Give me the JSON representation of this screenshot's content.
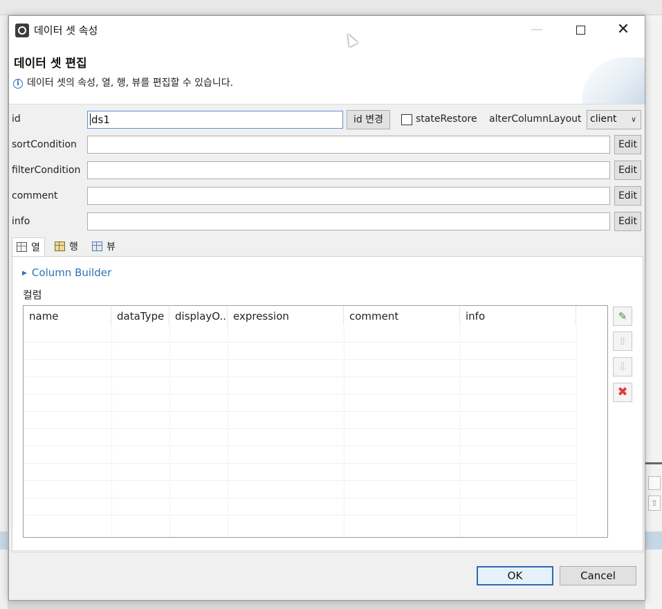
{
  "dialog": {
    "title": "데이터 셋 속성",
    "header_title": "데이터 셋 편집",
    "header_desc": "데이터 셋의 속성, 열, 행, 뷰를 편집할 수 있습니다."
  },
  "window_controls": {
    "minimize": "—",
    "maximize": "",
    "close": "✕"
  },
  "props": {
    "id": {
      "label": "id",
      "value": "ds1",
      "rename_button": "id 변경"
    },
    "state_restore": {
      "label": "stateRestore",
      "checked": false
    },
    "alter_column_layout": {
      "label": "alterColumnLayout",
      "value": "client",
      "chevron": "∨"
    },
    "sort_condition": {
      "label": "sortCondition",
      "value": "",
      "button": "Edit"
    },
    "filter_condition": {
      "label": "filterCondition",
      "value": "",
      "button": "Edit"
    },
    "comment": {
      "label": "comment",
      "value": "",
      "button": "Edit"
    },
    "info": {
      "label": "info",
      "value": "",
      "button": "Edit"
    }
  },
  "tabs": [
    {
      "label": "열",
      "icon": "column-grid-icon",
      "active": true
    },
    {
      "label": "행",
      "icon": "row-grid-icon",
      "active": false
    },
    {
      "label": "뷰",
      "icon": "view-grid-icon",
      "active": false
    }
  ],
  "columns_panel": {
    "builder_link": "Column Builder",
    "section_label": "컬럼",
    "headers": [
      "name",
      "dataType",
      "displayO...",
      "expression",
      "comment",
      "info"
    ],
    "rows": []
  },
  "side_buttons": {
    "add": "✎",
    "up": "⇧",
    "down": "⇩",
    "delete": "✖"
  },
  "footer": {
    "ok": "OK",
    "cancel": "Cancel"
  },
  "colors": {
    "accent": "#2a6bb3",
    "link": "#2c73b8",
    "delete": "#e03a3a"
  }
}
